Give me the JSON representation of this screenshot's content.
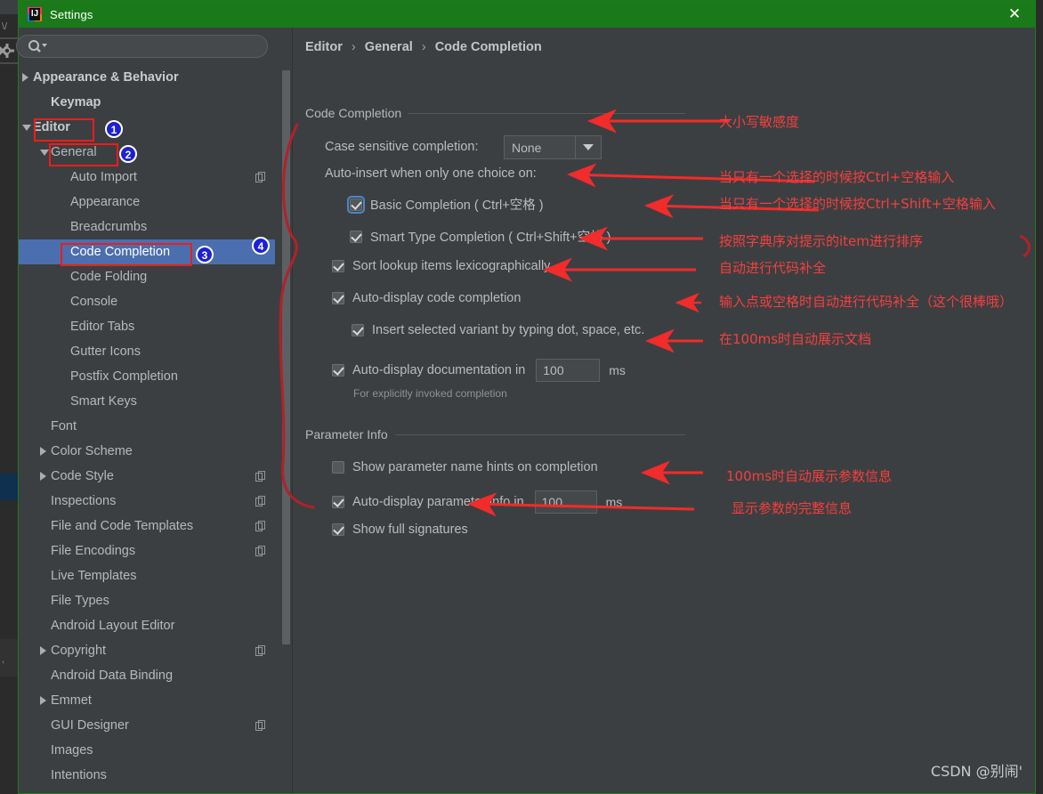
{
  "window": {
    "title": "Settings",
    "app_icon": "intellij-idea-icon",
    "close_icon": "close-icon",
    "titlebar_color": "#1a7a1a"
  },
  "search": {
    "placeholder": "",
    "value": "",
    "icon": "search-icon"
  },
  "sidebar": {
    "items": [
      {
        "label": "Appearance & Behavior",
        "indent": 0,
        "toggle": "right",
        "bold": true,
        "selected": false,
        "copy": false
      },
      {
        "label": "Keymap",
        "indent": 1,
        "toggle": "none",
        "bold": true,
        "selected": false,
        "copy": false
      },
      {
        "label": "Editor",
        "indent": 0,
        "toggle": "down",
        "bold": true,
        "selected": false,
        "copy": false
      },
      {
        "label": "General",
        "indent": 1,
        "toggle": "down",
        "bold": false,
        "selected": false,
        "copy": false
      },
      {
        "label": "Auto Import",
        "indent": 2,
        "toggle": "none",
        "bold": false,
        "selected": false,
        "copy": true
      },
      {
        "label": "Appearance",
        "indent": 2,
        "toggle": "none",
        "bold": false,
        "selected": false,
        "copy": false
      },
      {
        "label": "Breadcrumbs",
        "indent": 2,
        "toggle": "none",
        "bold": false,
        "selected": false,
        "copy": false
      },
      {
        "label": "Code Completion",
        "indent": 2,
        "toggle": "none",
        "bold": false,
        "selected": true,
        "copy": false
      },
      {
        "label": "Code Folding",
        "indent": 2,
        "toggle": "none",
        "bold": false,
        "selected": false,
        "copy": false
      },
      {
        "label": "Console",
        "indent": 2,
        "toggle": "none",
        "bold": false,
        "selected": false,
        "copy": false
      },
      {
        "label": "Editor Tabs",
        "indent": 2,
        "toggle": "none",
        "bold": false,
        "selected": false,
        "copy": false
      },
      {
        "label": "Gutter Icons",
        "indent": 2,
        "toggle": "none",
        "bold": false,
        "selected": false,
        "copy": false
      },
      {
        "label": "Postfix Completion",
        "indent": 2,
        "toggle": "none",
        "bold": false,
        "selected": false,
        "copy": false
      },
      {
        "label": "Smart Keys",
        "indent": 2,
        "toggle": "none",
        "bold": false,
        "selected": false,
        "copy": false
      },
      {
        "label": "Font",
        "indent": 1,
        "toggle": "none",
        "bold": false,
        "selected": false,
        "copy": false
      },
      {
        "label": "Color Scheme",
        "indent": 1,
        "toggle": "right",
        "bold": false,
        "selected": false,
        "copy": false
      },
      {
        "label": "Code Style",
        "indent": 1,
        "toggle": "right",
        "bold": false,
        "selected": false,
        "copy": true
      },
      {
        "label": "Inspections",
        "indent": 1,
        "toggle": "none",
        "bold": false,
        "selected": false,
        "copy": true
      },
      {
        "label": "File and Code Templates",
        "indent": 1,
        "toggle": "none",
        "bold": false,
        "selected": false,
        "copy": true
      },
      {
        "label": "File Encodings",
        "indent": 1,
        "toggle": "none",
        "bold": false,
        "selected": false,
        "copy": true
      },
      {
        "label": "Live Templates",
        "indent": 1,
        "toggle": "none",
        "bold": false,
        "selected": false,
        "copy": false
      },
      {
        "label": "File Types",
        "indent": 1,
        "toggle": "none",
        "bold": false,
        "selected": false,
        "copy": false
      },
      {
        "label": "Android Layout Editor",
        "indent": 1,
        "toggle": "none",
        "bold": false,
        "selected": false,
        "copy": false
      },
      {
        "label": "Copyright",
        "indent": 1,
        "toggle": "right",
        "bold": false,
        "selected": false,
        "copy": true
      },
      {
        "label": "Android Data Binding",
        "indent": 1,
        "toggle": "none",
        "bold": false,
        "selected": false,
        "copy": false
      },
      {
        "label": "Emmet",
        "indent": 1,
        "toggle": "right",
        "bold": false,
        "selected": false,
        "copy": false
      },
      {
        "label": "GUI Designer",
        "indent": 1,
        "toggle": "none",
        "bold": false,
        "selected": false,
        "copy": true
      },
      {
        "label": "Images",
        "indent": 1,
        "toggle": "none",
        "bold": false,
        "selected": false,
        "copy": false
      },
      {
        "label": "Intentions",
        "indent": 1,
        "toggle": "none",
        "bold": false,
        "selected": false,
        "copy": false
      }
    ]
  },
  "breadcrumb": {
    "part1": "Editor",
    "part2": "General",
    "part3": "Code Completion",
    "separator": "›"
  },
  "main": {
    "group_code_completion": "Code Completion",
    "group_parameter_info": "Parameter Info",
    "case_sensitive_label": "Case sensitive completion:",
    "case_sensitive_value": "None",
    "auto_insert_label": "Auto-insert when only one choice on:",
    "cb_basic": "Basic Completion ( Ctrl+空格 )",
    "cb_smart": "Smart Type Completion ( Ctrl+Shift+空格 )",
    "cb_sort": "Sort lookup items lexicographically",
    "cb_autodisplay": "Auto-display code completion",
    "cb_insert_variant": "Insert selected variant by typing dot, space, etc.",
    "cb_autodoc": "Auto-display documentation in",
    "autodoc_value": "100",
    "autodoc_unit": "ms",
    "autodoc_note": "For explicitly invoked completion",
    "cb_param_hints": "Show parameter name hints on completion",
    "cb_autoparam": "Auto-display parameter info in",
    "autoparam_value": "100",
    "autoparam_unit": "ms",
    "cb_full_sig": "Show full signatures"
  },
  "annotations": {
    "badge1": "1",
    "badge2": "2",
    "badge3": "3",
    "badge4": "4",
    "cn1": "大小写敏感度",
    "cn2": "当只有一个选择的时候按Ctrl+空格输入",
    "cn3": "当只有一个选择的时候按Ctrl+Shift+空格输入",
    "cn4": "按照字典序对提示的item进行排序",
    "cn5": "自动进行代码补全",
    "cn6": "输入点或空格时自动进行代码补全（这个很棒哦）",
    "cn7": "在100ms时自动展示文档",
    "cn8": "100ms时自动展示参数信息",
    "cn9": "显示参数的完整信息",
    "arrow_color": "#f22b2b",
    "box_color": "#ee1c1c",
    "badge_color": "#1c21d6"
  },
  "watermark": "CSDN @别闹'"
}
